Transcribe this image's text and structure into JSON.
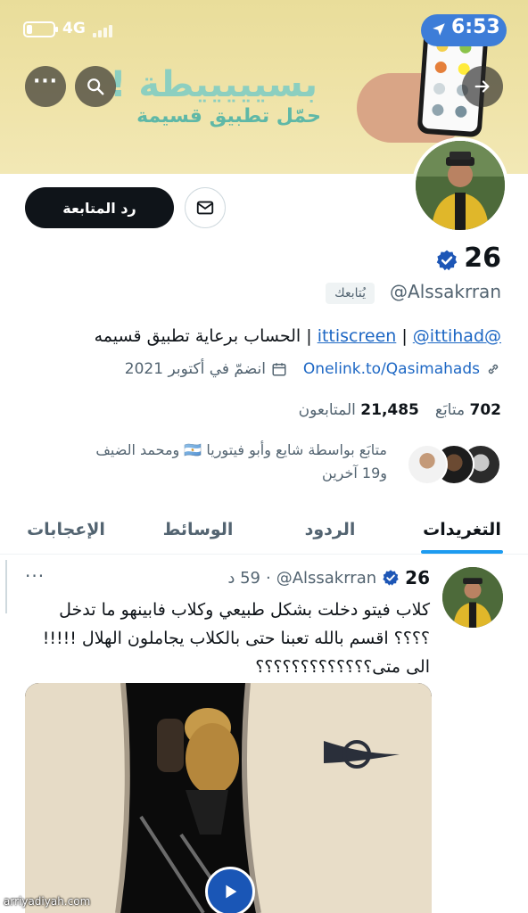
{
  "status_bar": {
    "network": "4G",
    "time": "6:53",
    "battery_level": 0.15
  },
  "banner": {
    "title": "بسيييييطة !",
    "subtitle": "حمّل تطبيق قسيمة"
  },
  "icons": {
    "more": "more-horizontal-icon",
    "search": "search-icon",
    "back": "arrow-right-icon",
    "message": "envelope-icon",
    "verified": "verified-badge-icon",
    "link": "link-icon",
    "calendar": "calendar-icon",
    "play": "play-icon"
  },
  "colors": {
    "accent": "#1d9bf0",
    "link": "#1d67c4",
    "verified": "#1d56b6",
    "banner": "#efe3a8"
  },
  "profile": {
    "follow_back_label": "رد المتابعة",
    "display_name": "26",
    "handle": "@Alssakrran",
    "follows_you_label": "يُتابعك",
    "bio": {
      "mention_1": "@ittiscreen",
      "separator_1": " | ",
      "mention_2": "@ittihad",
      "separator_2": " | ",
      "text": "الحساب برعاية تطبيق قسيمه"
    },
    "website": "Onelink.to/Qasimahads",
    "joined": "انضمّ في أكتوبر 2021",
    "following_count": "702",
    "following_label": "متابَع",
    "followers_count": "21,485",
    "followers_label": "المتابعون",
    "followed_by_line1": "متابَع بواسطة شايع وأبو فيتوريا 🇦🇷 ومحمد الضيف",
    "followed_by_line2": "و19 آخرين"
  },
  "tabs": [
    {
      "label": "التغريدات",
      "active": true
    },
    {
      "label": "الردود",
      "active": false
    },
    {
      "label": "الوسائط",
      "active": false
    },
    {
      "label": "الإعجابات",
      "active": false
    }
  ],
  "tweet": {
    "name": "26",
    "handle": "@Alssakrran",
    "separator": "·",
    "time": "59 د",
    "more": "···",
    "text": "كلاب فيتو دخلت بشكل طبيعي وكلاب فابينهو ما تدخل ؟؟؟؟ اقسم بالله تعبنا حتى بالكلاب يجاملون الهلال !!!!! الى متى؟؟؟؟؟؟؟؟؟؟؟؟؟"
  },
  "watermark": "arriyadiyah.com"
}
